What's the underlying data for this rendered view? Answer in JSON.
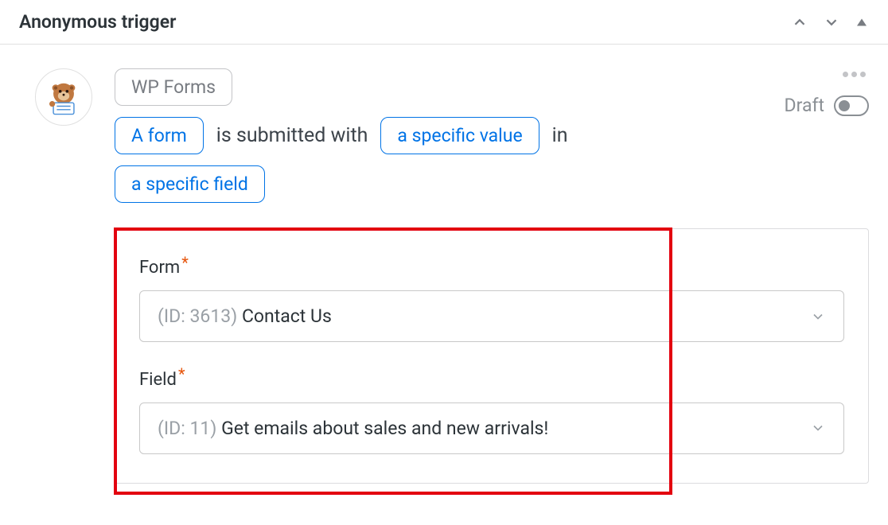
{
  "header": {
    "title": "Anonymous trigger"
  },
  "integration": {
    "badge": "WP Forms"
  },
  "sentence": {
    "token_form": "A form",
    "text_submitted": "is submitted with",
    "token_value": "a specific value",
    "text_in": "in",
    "token_field": "a specific field"
  },
  "status": {
    "label": "Draft"
  },
  "config": {
    "form": {
      "label": "Form",
      "value_id": "(ID: 3613)",
      "value_name": "Contact Us"
    },
    "field": {
      "label": "Field",
      "value_id": "(ID: 11)",
      "value_name": "Get emails about sales and new arrivals!"
    }
  }
}
